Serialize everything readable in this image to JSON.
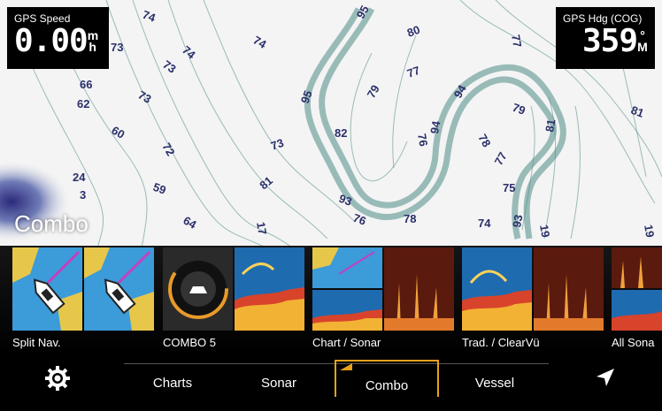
{
  "speed": {
    "label": "GPS Speed",
    "value": "0.00",
    "unit_top": "m",
    "unit_bottom": "h"
  },
  "heading": {
    "label": "GPS Hdg (COG)",
    "value": "359",
    "unit_top": "°",
    "unit_bottom": "M"
  },
  "page_title": "Combo",
  "depth_labels": [
    "74",
    "74",
    "74",
    "73",
    "73",
    "95",
    "80",
    "77",
    "66",
    "62",
    "73",
    "95",
    "79",
    "77",
    "94",
    "79",
    "81",
    "60",
    "72",
    "73",
    "82",
    "76",
    "94",
    "78",
    "81",
    "24",
    "3",
    "59",
    "81",
    "93",
    "77",
    "75",
    "64",
    "17",
    "76",
    "78",
    "74",
    "93",
    "19",
    "19"
  ],
  "combos": [
    {
      "label": "Split Nav."
    },
    {
      "label": "COMBO 5"
    },
    {
      "label": "Chart / Sonar"
    },
    {
      "label": "Trad. / ClearVü"
    },
    {
      "label": "All Sona"
    }
  ],
  "tabs": {
    "charts": "Charts",
    "sonar": "Sonar",
    "combo": "Combo",
    "vessel": "Vessel"
  },
  "colors": {
    "accent": "#e8a21a",
    "water": "#f4f4f4",
    "contour": "#4e8c86",
    "sonar_blue": "#1e6bb0"
  }
}
